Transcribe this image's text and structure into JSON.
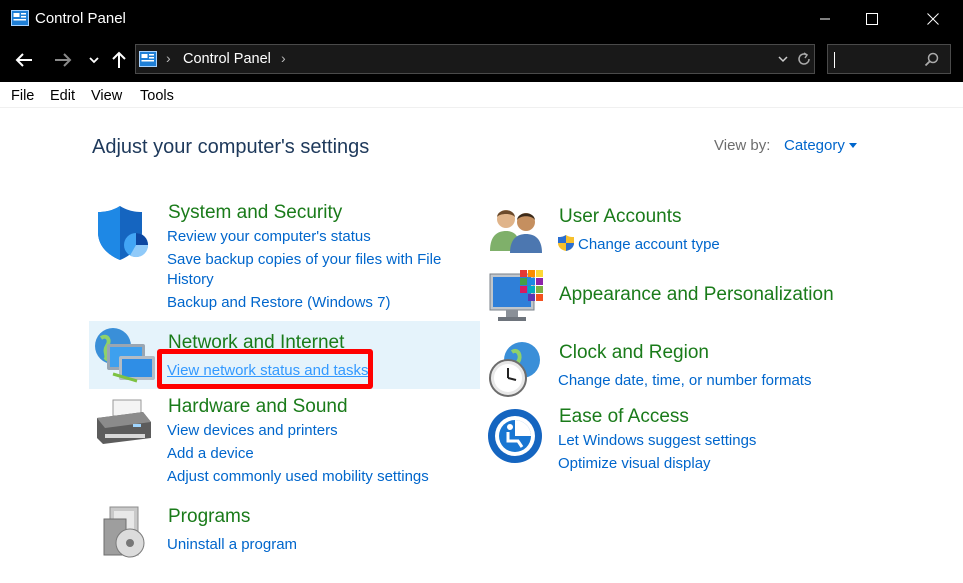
{
  "window": {
    "title": "Control Panel"
  },
  "address": {
    "crumb": "Control Panel"
  },
  "menu": {
    "file": "File",
    "edit": "Edit",
    "view": "View",
    "tools": "Tools"
  },
  "main": {
    "heading": "Adjust your computer's settings",
    "view_by_label": "View by:",
    "view_by_value": "Category"
  },
  "categories": {
    "system": {
      "title": "System and Security",
      "links": [
        "Review your computer's status",
        "Save backup copies of your files with File",
        "History",
        "Backup and Restore (Windows 7)"
      ]
    },
    "network": {
      "title": "Network and Internet",
      "links": [
        "View network status and tasks"
      ]
    },
    "hardware": {
      "title": "Hardware and Sound",
      "links": [
        "View devices and printers",
        "Add a device",
        "Adjust commonly used mobility settings"
      ]
    },
    "programs": {
      "title": "Programs",
      "links": [
        "Uninstall a program"
      ]
    },
    "users": {
      "title": "User Accounts",
      "links": [
        "Change account type"
      ]
    },
    "appearance": {
      "title": "Appearance and Personalization",
      "links": []
    },
    "clock": {
      "title": "Clock and Region",
      "links": [
        "Change date, time, or number formats"
      ]
    },
    "ease": {
      "title": "Ease of Access",
      "links": [
        "Let Windows suggest settings",
        "Optimize visual display"
      ]
    }
  },
  "colors": {
    "title_green": "#1a7b1a",
    "link_blue": "#0066cc",
    "heading": "#1e395b",
    "highlight": "#ff0000"
  },
  "icons": [
    "control-panel-icon",
    "minimize-icon",
    "maximize-icon",
    "close-icon",
    "back-arrow-icon",
    "forward-arrow-icon",
    "recent-dropdown-icon",
    "up-arrow-icon",
    "refresh-icon",
    "search-icon",
    "shield-icon",
    "network-globe-icon",
    "printer-icon",
    "programs-disc-icon",
    "users-icon",
    "uac-shield-icon",
    "monitor-palette-icon",
    "clock-globe-icon",
    "ease-of-access-icon"
  ]
}
